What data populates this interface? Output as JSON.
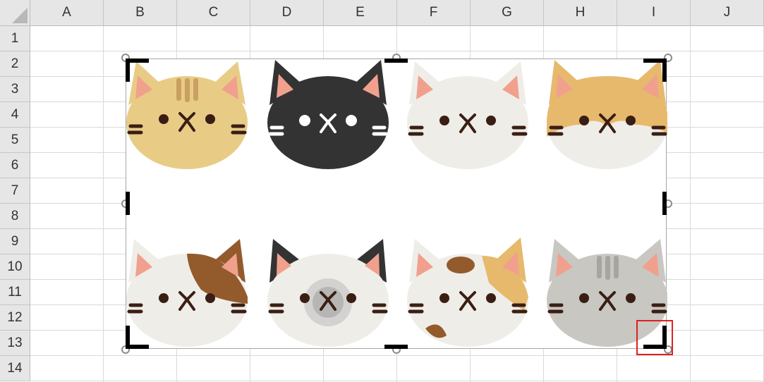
{
  "spreadsheet": {
    "columns": [
      "A",
      "B",
      "C",
      "D",
      "E",
      "F",
      "G",
      "H",
      "I",
      "J"
    ],
    "rows": [
      "1",
      "2",
      "3",
      "4",
      "5",
      "6",
      "7",
      "8",
      "9",
      "10",
      "11",
      "12",
      "13",
      "14"
    ]
  },
  "picture": {
    "content": "cat-faces",
    "cats": [
      "tabby",
      "black",
      "white",
      "orange-white",
      "brown-patch",
      "siamese",
      "calico",
      "gray-tabby"
    ]
  },
  "selection": {
    "state": "cropping",
    "highlight_color": "#e02020"
  }
}
